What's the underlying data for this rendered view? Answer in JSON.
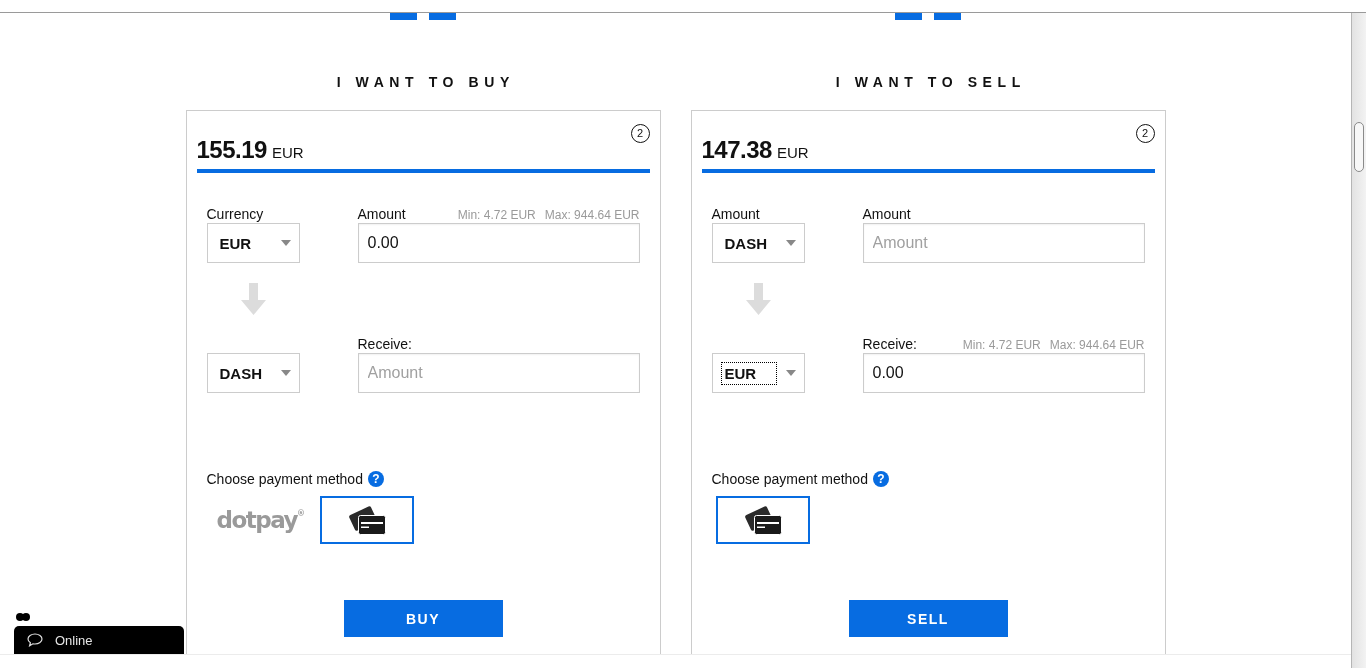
{
  "panels": [
    {
      "heading": "I WANT TO BUY",
      "price": "155.19",
      "price_currency": "EUR",
      "step": "2",
      "from": {
        "label": "Currency",
        "currency": "EUR",
        "focused": false
      },
      "amount": {
        "label": "Amount",
        "value": "0.00",
        "limits": [
          "Min: 4.72 EUR",
          "Max: 944.64 EUR"
        ]
      },
      "to": {
        "currency": "DASH",
        "focused": false
      },
      "receive": {
        "label": "Receive:",
        "placeholder": "Amount"
      },
      "payment_label": "Choose payment method",
      "help": "?",
      "payment_methods": [
        {
          "kind": "logo",
          "label": "dotpay$^{®}$",
          "selected": false
        },
        {
          "kind": "card",
          "selected": true
        }
      ],
      "button": "BUY"
    },
    {
      "heading": "I WANT TO SELL",
      "price": "147.38",
      "price_currency": "EUR",
      "step": "2",
      "from": {
        "label": "Amount",
        "currency": "DASH",
        "focused": false
      },
      "amount": {
        "label": "Amount",
        "placeholder": "Amount"
      },
      "to": {
        "currency": "EUR",
        "focused": true
      },
      "receive": {
        "label": "Receive:",
        "value": "0.00",
        "limits": [
          "Min: 4.72 EUR",
          "Max: 944.64 EUR"
        ]
      },
      "payment_label": "Choose payment method",
      "help": "?",
      "payment_methods": [
        {
          "kind": "card",
          "selected": true
        }
      ],
      "button": "SELL"
    }
  ],
  "chat": {
    "label": "Online"
  }
}
